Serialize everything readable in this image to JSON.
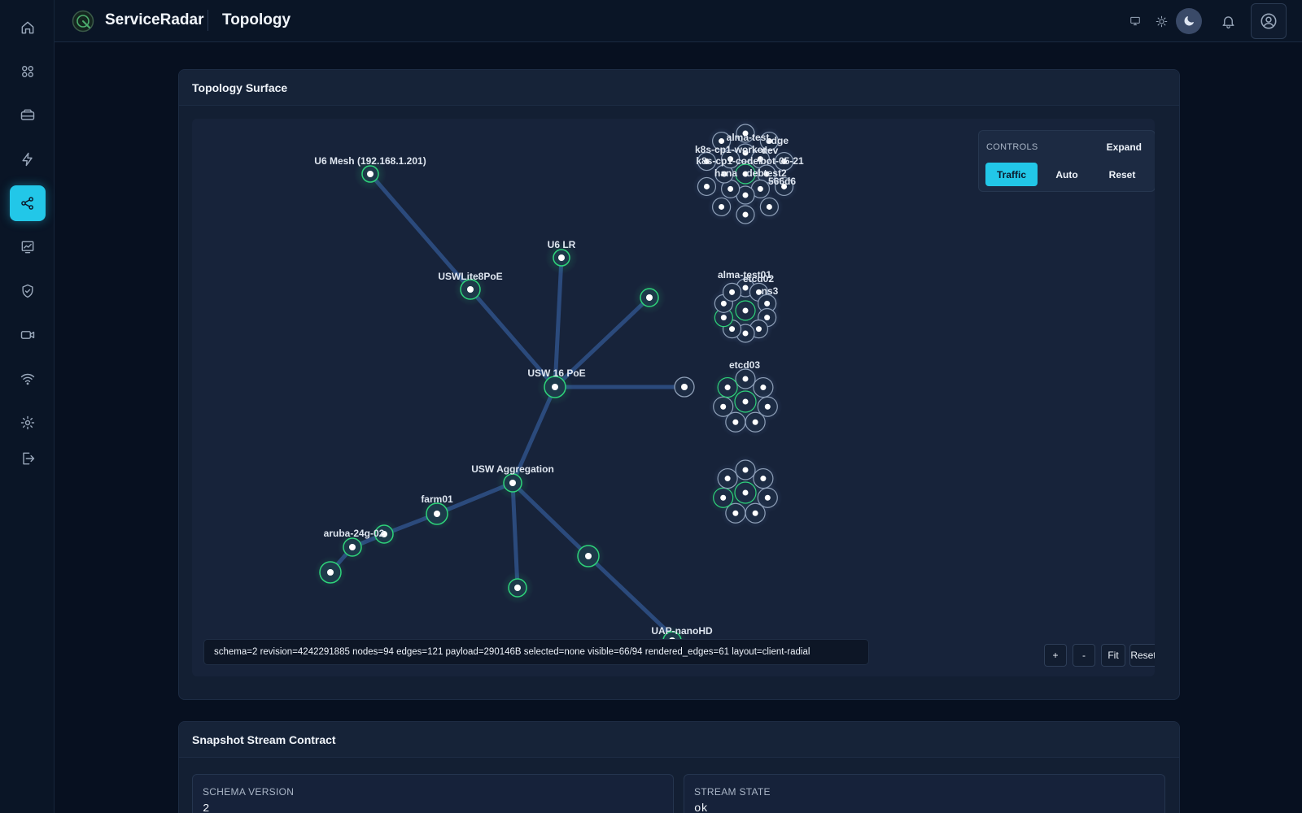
{
  "app": {
    "brand": "ServiceRadar",
    "page_title": "Topology"
  },
  "sidebar": {
    "items": [
      {
        "icon": "home-icon",
        "active": false
      },
      {
        "icon": "dashboard-grid-icon",
        "active": false
      },
      {
        "icon": "devices-icon",
        "active": false
      },
      {
        "icon": "events-bolt-icon",
        "active": false
      },
      {
        "icon": "topology-share-icon",
        "active": true
      },
      {
        "icon": "analytics-chart-icon",
        "active": false
      },
      {
        "icon": "shield-check-icon",
        "active": false
      },
      {
        "icon": "camera-icon",
        "active": false
      },
      {
        "icon": "wifi-icon",
        "active": false
      },
      {
        "icon": "settings-gear-icon",
        "active": false
      },
      {
        "icon": "sign-out-icon",
        "active": false
      }
    ]
  },
  "topology": {
    "title": "Topology Surface",
    "controls": {
      "title": "CONTROLS",
      "expand": "Expand",
      "buttons": [
        {
          "label": "Traffic",
          "active": true
        },
        {
          "label": "Auto",
          "active": false
        },
        {
          "label": "Reset",
          "active": false
        }
      ]
    },
    "status": "schema=2 revision=4242291885 nodes=94 edges=121 payload=290146B selected=none visible=66/94 rendered_edges=61 layout=client-radial",
    "zoom": {
      "plus": "+",
      "minus": "-",
      "fit": "Fit",
      "reset": "Reset"
    },
    "labels": [
      "U6 Mesh (192.168.1.201)",
      "U6 LR",
      "USWLite8PoE",
      "USW 16 PoE",
      "USW Aggregation",
      "farm01",
      "aruba-24g-02",
      "UAP-nanoHD",
      "alma-test01",
      "etcd02",
      "ns3",
      "etcd03",
      "k8s-cp1-worker",
      "alma-test",
      "edge",
      "k8s-cp1-coder",
      "dev",
      "bot-05-21",
      "hana",
      "debtest2",
      "566d6"
    ]
  },
  "snapshot": {
    "title": "Snapshot Stream Contract",
    "cards": [
      {
        "label": "SCHEMA VERSION",
        "value": "2"
      },
      {
        "label": "STREAM STATE",
        "value": "ok"
      }
    ]
  },
  "colors": {
    "accent": "#22c7e8",
    "node_ring_green": "#2ed47a",
    "edge": "#2b4a7c"
  }
}
